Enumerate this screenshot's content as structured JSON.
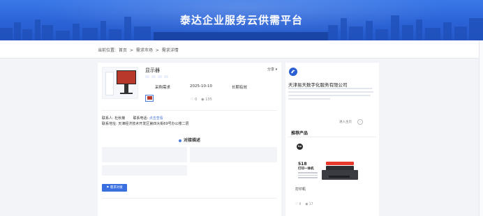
{
  "banner": {
    "title": "泰达企业服务云供需平台"
  },
  "breadcrumb": {
    "prefix": "当前位置:",
    "items": [
      "首页",
      "需求市场",
      "需求详情"
    ],
    "separator": ">"
  },
  "product": {
    "title": "显示器",
    "share_label": "分享 ▾",
    "tags": [
      "",
      "",
      "",
      ""
    ],
    "meta": [
      {
        "value": "采购需求"
      },
      {
        "value": "2025-10-10"
      },
      {
        "value": "长期有效"
      }
    ],
    "stats": {
      "likes": "0",
      "views": "135"
    },
    "contact_label": "联系人:",
    "contact_name": "杜秋菊",
    "phone_label": "联系电话:",
    "phone_value": "点击查看",
    "address_label": "联系地址:",
    "address_value": "天津经济技术开发区第四大街69号办公楼二层"
  },
  "section": {
    "title": "对接描述"
  },
  "details": {
    "industry": "",
    "quantity": "",
    "budget": ""
  },
  "actions": {
    "contact_button": "需求对接"
  },
  "company": {
    "name": "天津易天数字化服务有限公司",
    "enter_label": "进入主页"
  },
  "recommend": {
    "title": "推荐产品",
    "product_number": "518",
    "product_name": "打印一体机",
    "product_title": "打印机",
    "product_company": "",
    "likes": "0",
    "views": "17"
  }
}
